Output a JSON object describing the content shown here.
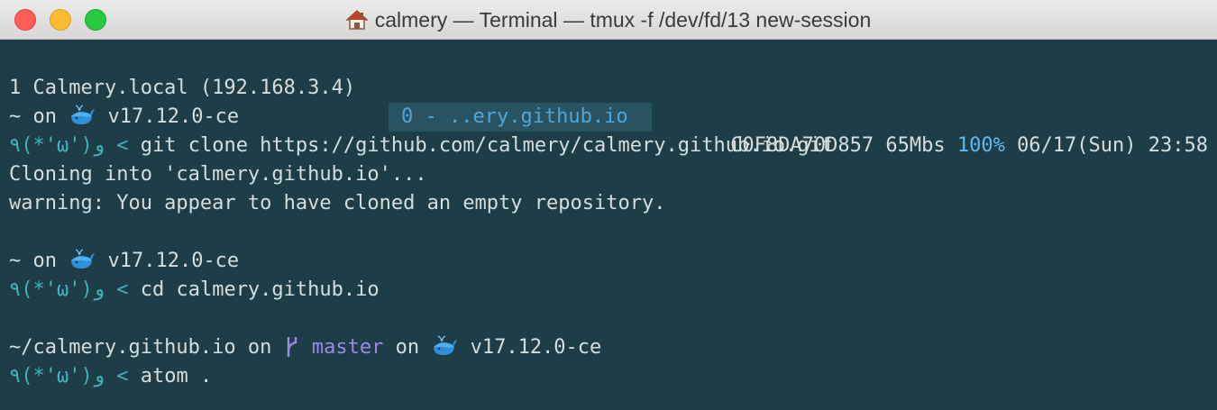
{
  "window": {
    "title": "calmery — Terminal — tmux -f /dev/fd/13 new-session",
    "title_icon": "house-icon"
  },
  "status_bar": {
    "left": "1 Calmery.local (192.168.3.4)",
    "window_tab": "0 - ..ery.github.io",
    "host_id": "C0F8DA70D857",
    "speed": "65Mbs",
    "battery": "100%",
    "date": "06/17(Sun)",
    "time": "23:58"
  },
  "prompt": {
    "face": "٩(*'ω')و",
    "arrow": "<",
    "docker_icon": "whale-icon",
    "branch_icon": "git-branch-icon"
  },
  "lines": {
    "block1_dir": "~ on ",
    "block1_docker": " v17.12.0-ce",
    "block1_cmd": " git clone https://github.com/calmery/calmery.github.io.git",
    "output1": "Cloning into 'calmery.github.io'...",
    "output2": "warning: You appear to have cloned an empty repository.",
    "block2_dir": "~ on ",
    "block2_docker": " v17.12.0-ce",
    "block2_cmd": " cd calmery.github.io",
    "block3_dir": "~/calmery.github.io on ",
    "block3_branch": " master",
    "block3_on": " on ",
    "block3_docker": " v17.12.0-ce",
    "block3_cmd": " atom ."
  },
  "colors": {
    "background": "#1f3d47",
    "text": "#d3dedd",
    "prompt": "#3fb4bc",
    "branch": "#9a8ae8",
    "status_highlight": "#4fa6d6"
  }
}
